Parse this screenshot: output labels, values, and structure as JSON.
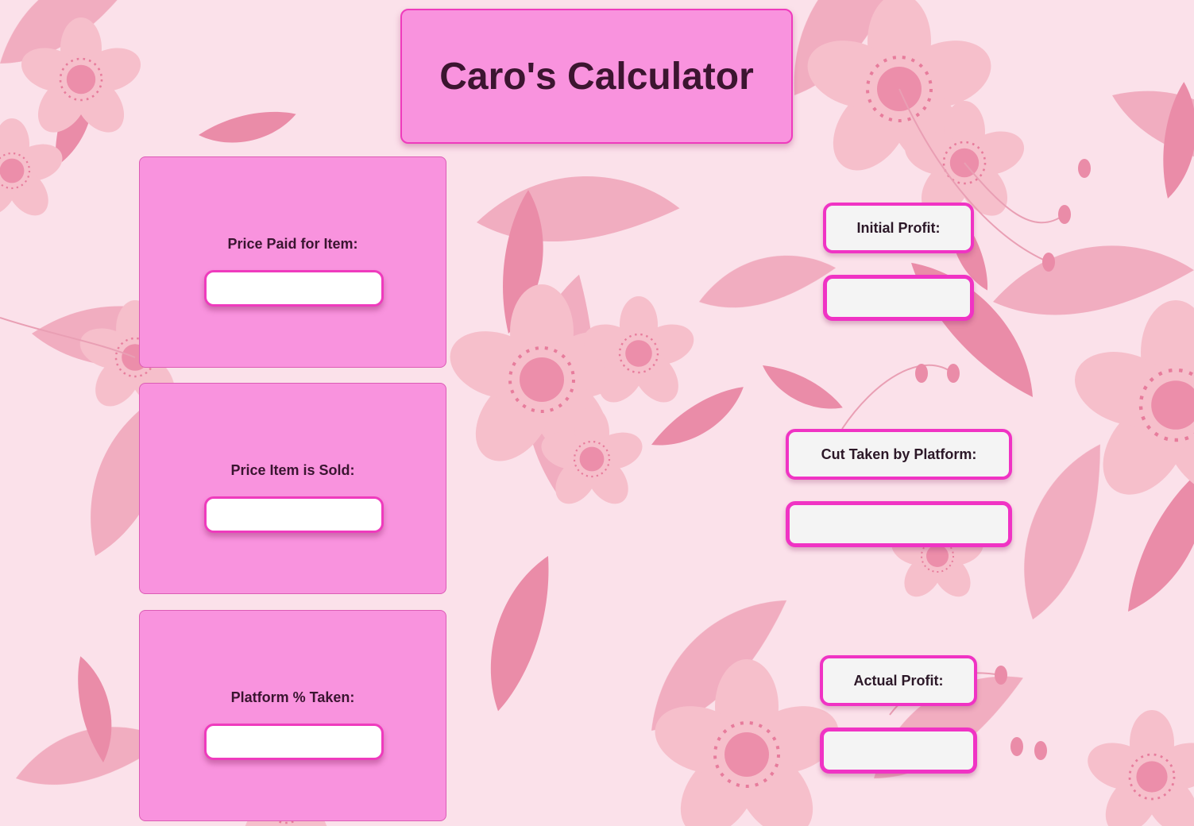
{
  "title": "Caro's Calculator",
  "colors": {
    "background": "#fbe1ea",
    "card": "#f993de",
    "accent_border": "#ef3bbd",
    "output_bg": "#f4f4f4",
    "text": "#3c1530"
  },
  "inputs": [
    {
      "label": "Price Paid for Item:",
      "value": ""
    },
    {
      "label": "Price Item is Sold:",
      "value": ""
    },
    {
      "label": "Platform % Taken:",
      "value": ""
    }
  ],
  "outputs": [
    {
      "label": "Initial Profit:",
      "value": ""
    },
    {
      "label": "Cut Taken by Platform:",
      "value": ""
    },
    {
      "label": "Actual Profit:",
      "value": ""
    }
  ]
}
